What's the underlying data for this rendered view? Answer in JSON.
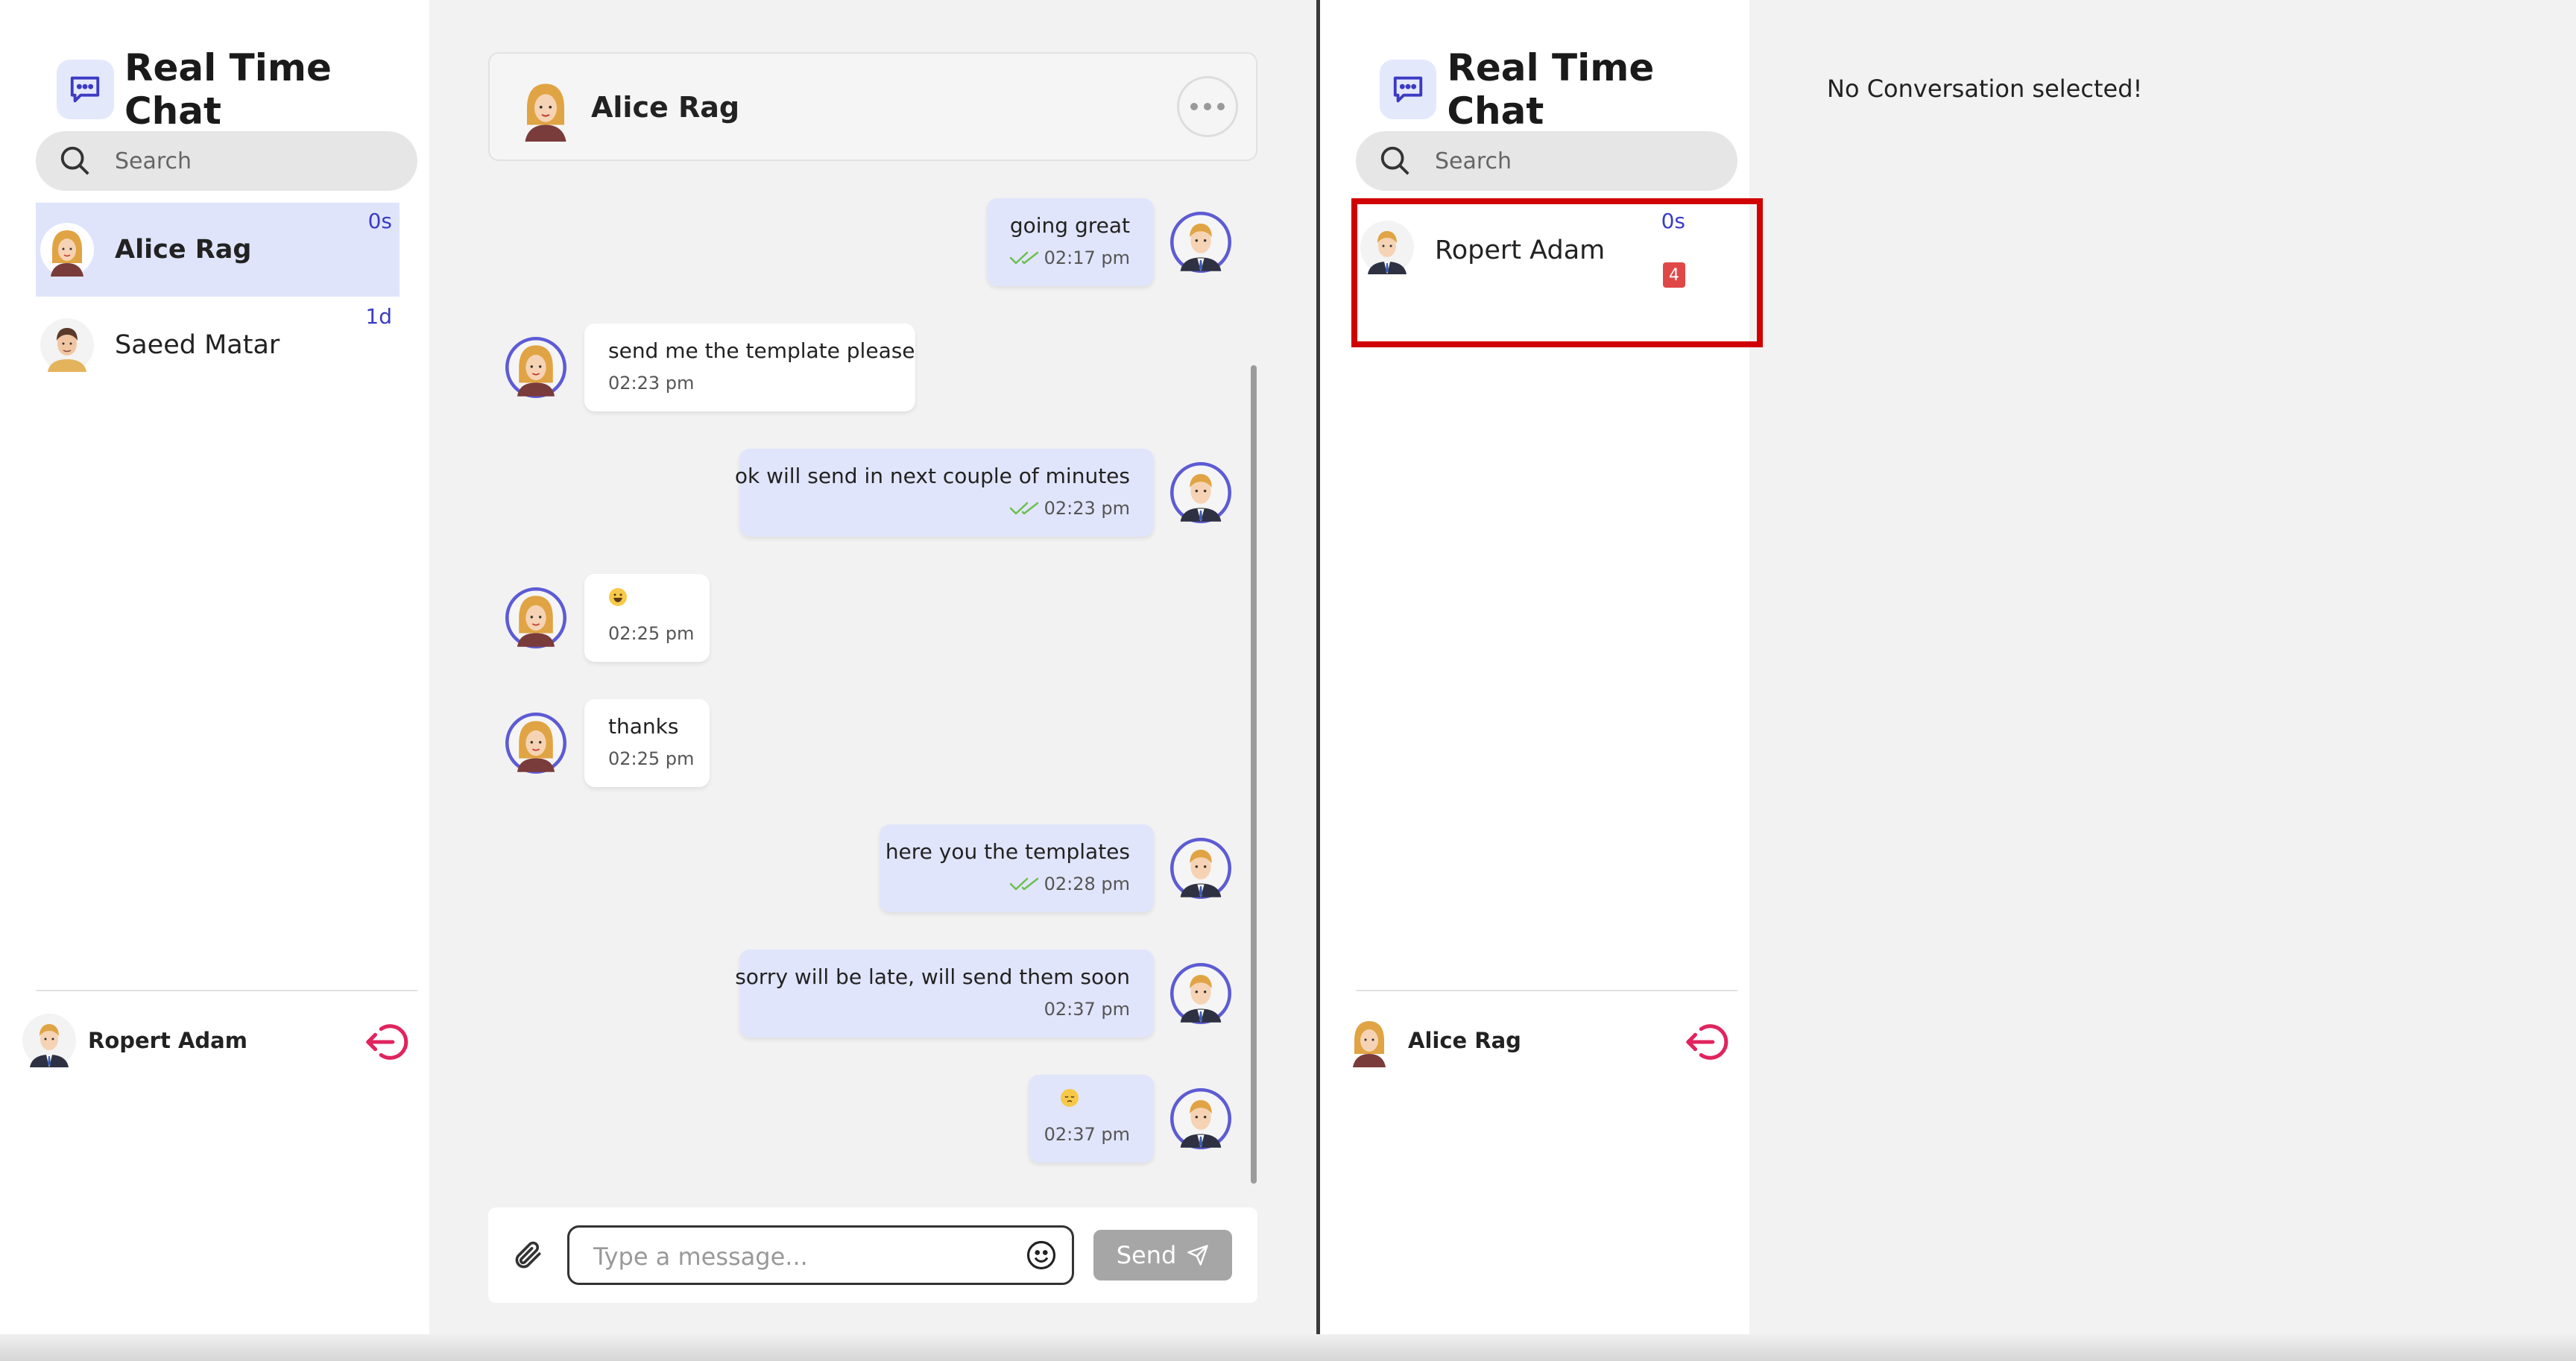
{
  "left_window": {
    "app_title": "Real Time Chat",
    "search_placeholder": "Search",
    "conversations": [
      {
        "name": "Alice Rag",
        "time": "0s",
        "active": true
      },
      {
        "name": "Saeed Matar",
        "time": "1d",
        "active": false
      }
    ],
    "current_user": "Ropert Adam",
    "chat": {
      "title": "Alice Rag",
      "messages": [
        {
          "direction": "out",
          "text": "going great",
          "time": "02:17 pm",
          "read": true
        },
        {
          "direction": "in",
          "text": "send me the template please",
          "time": "02:23 pm"
        },
        {
          "direction": "out",
          "text": "ok will send in next couple of minutes",
          "time": "02:23 pm",
          "read": true
        },
        {
          "direction": "in",
          "emoji": "grinning-face-emoji",
          "time": "02:25 pm"
        },
        {
          "direction": "in",
          "text": "thanks",
          "time": "02:25 pm"
        },
        {
          "direction": "out",
          "text": "here you the templates",
          "time": "02:28 pm",
          "read": true
        },
        {
          "direction": "out",
          "text": "sorry will be late, will send them soon",
          "time": "02:37 pm",
          "read": false
        },
        {
          "direction": "out",
          "emoji": "pensive-face-emoji",
          "time": "02:37 pm",
          "read": false
        }
      ],
      "composer_placeholder": "Type a message...",
      "send_label": "Send"
    }
  },
  "right_window": {
    "app_title": "Real Time Chat",
    "search_placeholder": "Search",
    "conversations": [
      {
        "name": "Ropert Adam",
        "time": "0s",
        "unread": "4"
      }
    ],
    "current_user": "Alice Rag",
    "empty_state": "No Conversation selected!"
  },
  "colors": {
    "accent": "#3b3bc4",
    "active_row": "#dfe4fb",
    "outgoing_bubble": "#e1e5fb",
    "logout": "#e0245e",
    "badge": "#e04848",
    "highlight": "#d00000"
  }
}
